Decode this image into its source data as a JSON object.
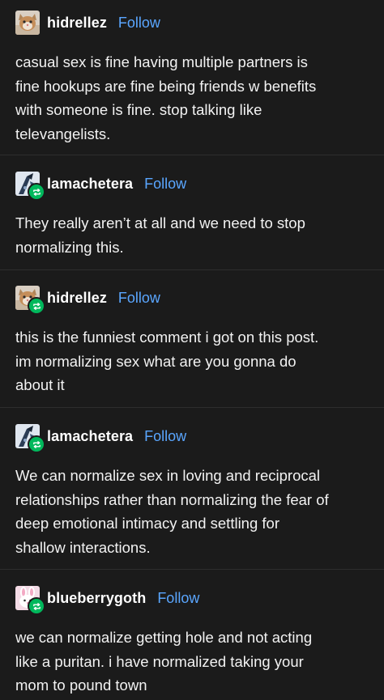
{
  "theme": {
    "background": "#1b1b1b",
    "text": "#f2f2f2",
    "link": "#5aa6ff",
    "reblog_badge": "#00b85c",
    "divider": "#2e2e2e"
  },
  "posts": [
    {
      "username": "hidrellez",
      "follow_label": "Follow",
      "avatar_icon": "cat-avatar",
      "reblogged": false,
      "text": "casual sex is fine having multiple partners is\nfine hookups are fine being friends w benefits\nwith someone is fine. stop talking like\ntelevangelists."
    },
    {
      "username": "lamachetera",
      "follow_label": "Follow",
      "avatar_icon": "dark-art-avatar",
      "reblogged": true,
      "text": "They really aren’t at all and we need to stop\nnormalizing this."
    },
    {
      "username": "hidrellez",
      "follow_label": "Follow",
      "avatar_icon": "cat-avatar",
      "reblogged": true,
      "text": "this is the funniest comment i got on this post.\nim normalizing sex what are you gonna do\nabout it"
    },
    {
      "username": "lamachetera",
      "follow_label": "Follow",
      "avatar_icon": "dark-art-avatar",
      "reblogged": true,
      "text": "We can normalize sex in loving and reciprocal\nrelationships rather than normalizing the fear of\ndeep emotional intimacy and settling for\nshallow interactions."
    },
    {
      "username": "blueberrygoth",
      "follow_label": "Follow",
      "avatar_icon": "pink-bunny-avatar",
      "reblogged": true,
      "text": "we can normalize getting hole and not acting\nlike a puritan. i have normalized taking your\nmom to pound town"
    }
  ]
}
